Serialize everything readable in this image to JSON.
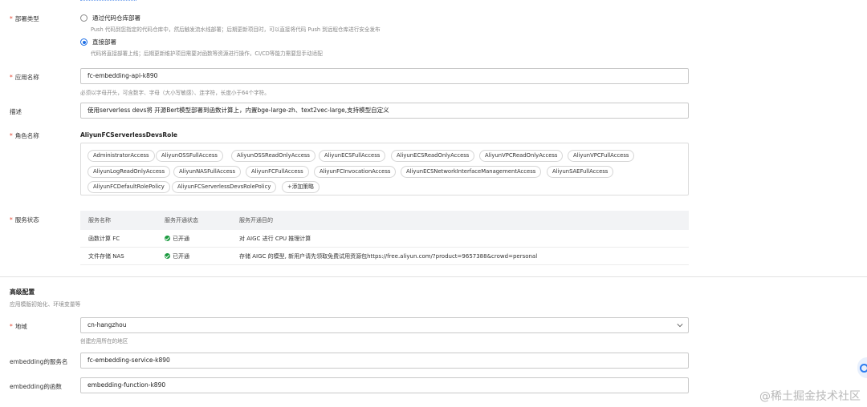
{
  "deploy_type": {
    "label": "部署类型",
    "options": [
      {
        "title": "通过代码仓库部署",
        "desc": "Push 代码到您指定的代码仓库中，然后触发流水线部署；后期更新项目时，可以直接将代码 Push 到远程仓库进行安全发布",
        "selected": false
      },
      {
        "title": "直接部署",
        "desc": "代码将直接部署上线；后期更新维护项目需要对函数等资源进行操作，CI/CD等能力需要您手动适配",
        "selected": true
      }
    ]
  },
  "app_name": {
    "label": "应用名称",
    "value": "fc-embedding-api-k890",
    "help": "必须以字母开头，可含数字、字母（大小写敏感）、连字符，长度小于64个字符。"
  },
  "description": {
    "label": "描述",
    "value": "使用serverless devs将 开源Bert模型部署到函数计算上，内置bge-large-zh、text2vec-large,支持模型自定义"
  },
  "role": {
    "label": "角色名称",
    "name": "AliyunFCServerlessDevsRole",
    "policies": [
      "AdministratorAccess",
      "AliyunOSSFullAccess",
      "AliyunOSSReadOnlyAccess",
      "AliyunECSFullAccess",
      "AliyunECSReadOnlyAccess",
      "AliyunVPCReadOnlyAccess",
      "AliyunVPCFullAccess",
      "AliyunLogReadOnlyAccess",
      "AliyunNASFullAccess",
      "AliyunFCFullAccess",
      "AliyunFCInvocationAccess",
      "AliyunECSNetworkInterfaceManagementAccess",
      "AliyunSAEFullAccess",
      "AliyunFCDefaultRolePolicy",
      "AliyunFCServerlessDevsRolePolicy"
    ],
    "add_policy": "+添加策略"
  },
  "service_status": {
    "label": "服务状态",
    "columns": [
      "服务名称",
      "服务开通状态",
      "服务开通目的"
    ],
    "rows": [
      {
        "name": "函数计算 FC",
        "status": "已开通",
        "purpose": "对 AIGC 进行 CPU 推理计算"
      },
      {
        "name": "文件存储 NAS",
        "status": "已开通",
        "purpose": "存储 AIGC 的模型, 新用户请先领取免费试用资源包https://free.aliyun.com/?product=9657388&crowd=personal"
      }
    ]
  },
  "advanced": {
    "title": "高级配置",
    "subtitle": "应用模版初始化、环境变量等"
  },
  "region": {
    "label": "地域",
    "value": "cn-hangzhou",
    "help": "创建应用所在的地区"
  },
  "service_name": {
    "label": "embedding的服务名",
    "value": "fc-embedding-service-k890"
  },
  "function_name": {
    "label": "embedding的函数",
    "value": "embedding-function-k890"
  },
  "watermark": "@稀土掘金技术社区",
  "colors": {
    "primary": "#1e6fe6",
    "required": "#e3442f",
    "success": "#1a9a3f"
  }
}
